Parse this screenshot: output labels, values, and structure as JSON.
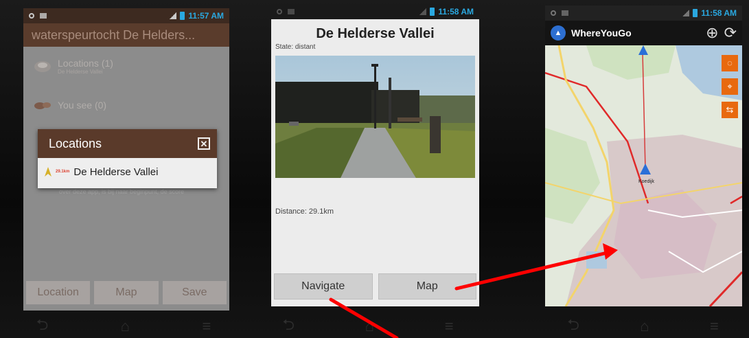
{
  "panel1": {
    "time": "11:57 AM",
    "title": "waterspeurtocht De Helders...",
    "items": [
      {
        "label": "Locations (1)",
        "sub": "De Helderse Vallei",
        "icon": "locations-icon"
      },
      {
        "label": "You see (0)",
        "sub": "",
        "icon": "you-see-icon"
      }
    ],
    "dim_text": "over deze app, is bij naar beginpunt, de score",
    "dialog": {
      "title": "Locations",
      "row_distance": "29.1km",
      "row_label": "De Helderse Vallei"
    },
    "buttons": [
      "Location",
      "Map",
      "Save"
    ]
  },
  "panel2": {
    "time": "11:58 AM",
    "title": "De Helderse Vallei",
    "state": "State: distant",
    "distance": "Distance: 29.1km",
    "buttons": {
      "navigate": "Navigate",
      "map": "Map"
    }
  },
  "panel3": {
    "time": "11:58 AM",
    "app_title": "WhereYouGo",
    "map_label": "Koedijk"
  },
  "colors": {
    "dialog_header": "#5a3a2a",
    "map_button": "#e8690e",
    "arrow": "#ff0000"
  }
}
